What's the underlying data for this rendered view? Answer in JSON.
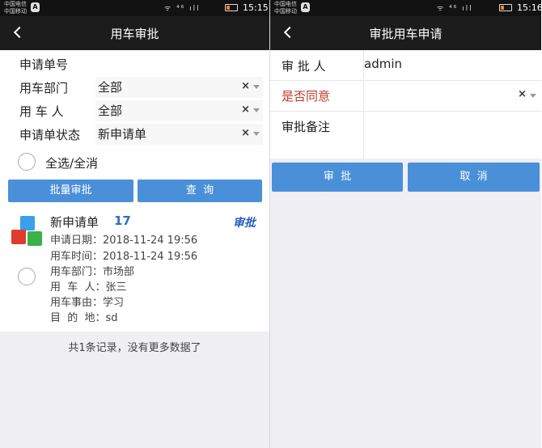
{
  "left": {
    "status": {
      "carrier_lines": [
        "中国电信",
        "中国移动"
      ],
      "signal_icons": "ᯤ ⁴⁶ ıll",
      "time": "15:15"
    },
    "nav": {
      "title": "用车审批"
    },
    "form": {
      "fields": [
        {
          "label": "申请单号",
          "value": ""
        },
        {
          "label": "用车部门",
          "value": "全部"
        },
        {
          "label": "用 车 人",
          "value": "全部"
        },
        {
          "label": "申请单状态",
          "value": "新申请单"
        }
      ],
      "select_all_label": "全选/全消",
      "batch_button": "批量审批",
      "query_button": "查  询",
      "clear_symbol": "×"
    },
    "record": {
      "title": "新申请单",
      "count": "17",
      "action": "审批",
      "details": [
        "申请日期：2018-11-24 19:56",
        "用车时间：2018-11-24 19:56",
        "用车部门：市场部",
        "用  车  人：张三",
        "用车事由：学习",
        "目  的  地：sd"
      ]
    },
    "footer_text": "共1条记录，没有更多数据了"
  },
  "right": {
    "status": {
      "carrier_lines": [
        "中国电信",
        "中国移动"
      ],
      "signal_icons": "ᯤ ⁴⁶ ıll",
      "time": "15:16"
    },
    "nav": {
      "title": "审批用车申请"
    },
    "form": {
      "approver_label": "审 批 人",
      "approver_value": "admin",
      "agree_label": "是否同意",
      "agree_value": "",
      "remark_label": "审批备注",
      "remark_value": "",
      "clear_symbol": "×"
    },
    "approve_button": "审  批",
    "cancel_button": "取  消"
  },
  "colors": {
    "accent": "#4a90d9",
    "agree_label": "#c0392b",
    "count": "#2a6fc0",
    "nav_bg": "#1c1c1c"
  },
  "icons": [
    "back-arrow-icon",
    "cube-stack-icon",
    "clear-icon",
    "dropdown-caret-icon",
    "battery-icon",
    "wifi-icon",
    "signal-icon"
  ]
}
